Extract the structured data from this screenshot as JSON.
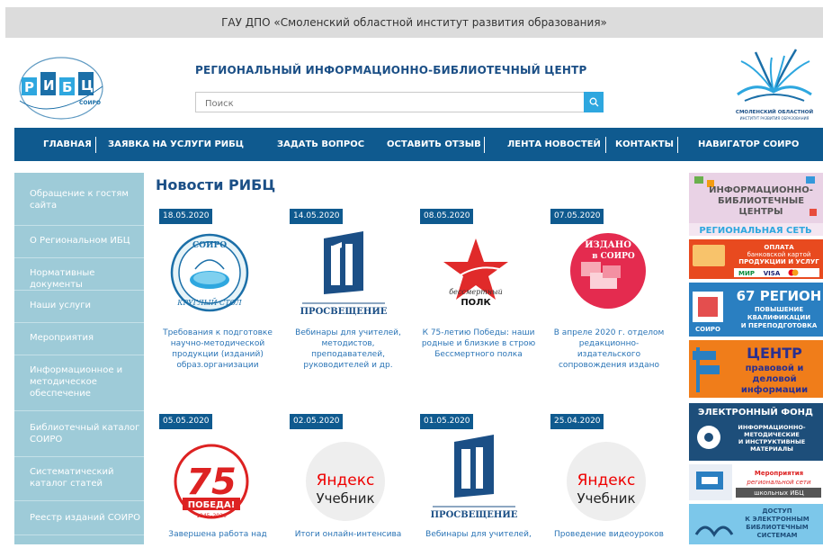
{
  "topbar": {
    "title": "ГАУ ДПО «Смоленский областной институт развития образования»"
  },
  "header": {
    "logo_text": "Р И Б Ц",
    "logo_sub": "СОИРО",
    "site_title": "РЕГИОНАЛЬНЫЙ ИНФОРМАЦИОННО-БИБЛИОТЕЧНЫЙ ЦЕНТР",
    "search_placeholder": "Поиск",
    "emblem_text1": "СМОЛЕНСКИЙ ОБЛАСТНОЙ",
    "emblem_text2": "ИНСТИТУТ РАЗВИТИЯ ОБРАЗОВАНИЯ"
  },
  "nav": {
    "items": [
      "ГЛАВНАЯ",
      "ЗАЯВКА НА УСЛУГИ РИБЦ",
      "ЗАДАТЬ ВОПРОС",
      "ОСТАВИТЬ ОТЗЫВ",
      "ЛЕНТА НОВОСТЕЙ",
      "КОНТАКТЫ",
      "НАВИГАТОР СОИРО"
    ]
  },
  "sidebar": {
    "items": [
      "Обращение к гостям сайта",
      "О Региональном ИБЦ",
      "Нормативные документы",
      "Наши услуги",
      "Мероприятия",
      "Информационное и методическое обеспечение",
      "Библиотечный каталог СОИРО",
      "Систематический каталог статей",
      "Реестр изданий СОИРО"
    ]
  },
  "news": {
    "title": "Новости РИБЦ",
    "cards": [
      {
        "date": "18.05.2020",
        "text": "Требования к подготовке научно-методической продукции (изданий) образ.организации",
        "img_label1": "СОИРО",
        "img_label2": "КРУГЛЫЙ СТОЛ"
      },
      {
        "date": "14.05.2020",
        "text": "Вебинары для учителей, методистов, преподавателей, руководителей и др.",
        "img_label1": "ПРОСВЕЩЕНИЕ"
      },
      {
        "date": "08.05.2020",
        "text": "К 75-летию Победы: наши родные и близкие в строю Бессмертного полка",
        "img_label1": "бессмертный",
        "img_label2": "ПОЛК"
      },
      {
        "date": "07.05.2020",
        "text": "В апреле 2020 г. отделом редакционно-издательского сопровождения издано",
        "img_label1": "ИЗДАНО",
        "img_label2": "в СОИРО"
      },
      {
        "date": "05.05.2020",
        "text": "Завершена работа над",
        "img_label1": "75",
        "img_label2": "ПОБЕДА!",
        "img_label3": "1945–2020"
      },
      {
        "date": "02.05.2020",
        "text": "Итоги онлайн-интенсива",
        "img_label1": "Яндекс",
        "img_label2": "Учебник"
      },
      {
        "date": "01.05.2020",
        "text": "Вебинары для учителей,",
        "img_label1": "ПРОСВЕЩЕНИЕ"
      },
      {
        "date": "25.04.2020",
        "text": "Проведение видеоуроков",
        "img_label1": "Яндекс",
        "img_label2": "Учебник"
      }
    ]
  },
  "banners": {
    "b1": [
      "ИНФОРМАЦИОННО-",
      "БИБЛИОТЕЧНЫЕ",
      "ЦЕНТРЫ",
      "РЕГИОНАЛЬНАЯ СЕТЬ"
    ],
    "b2": [
      "ОПЛАТА",
      "банковской картой",
      "ПРОДУКЦИИ И УСЛУГ",
      "МИР",
      "VISA"
    ],
    "b3": [
      "67 РЕГИОН",
      "ПОВЫШЕНИЕ",
      "КВАЛИФИКАЦИИ",
      "И ПЕРЕПОДГОТОВКА",
      "СОИРО"
    ],
    "b4": [
      "ЦЕНТР",
      "правовой и",
      "деловой",
      "информации"
    ],
    "b5": [
      "ЭЛЕКТРОННЫЙ ФОНД",
      "ИНФОРМАЦИОННО-",
      "МЕТОДИЧЕСКИЕ",
      "И ИНСТРУКТИВНЫЕ",
      "МАТЕРИАЛЫ"
    ],
    "b6": [
      "Мероприятия",
      "региональной сети",
      "школьных ИБЦ"
    ],
    "b7": [
      "ДОСТУП",
      "К ЭЛЕКТРОННЫМ",
      "БИБЛИОТЕЧНЫМ",
      "СИСТЕМАМ"
    ]
  },
  "colors": {
    "nav": "#0f5a8f",
    "sidebar": "#9ecbd8",
    "title": "#1b4f86",
    "link": "#2a74b6",
    "accent": "#2ea7df"
  }
}
